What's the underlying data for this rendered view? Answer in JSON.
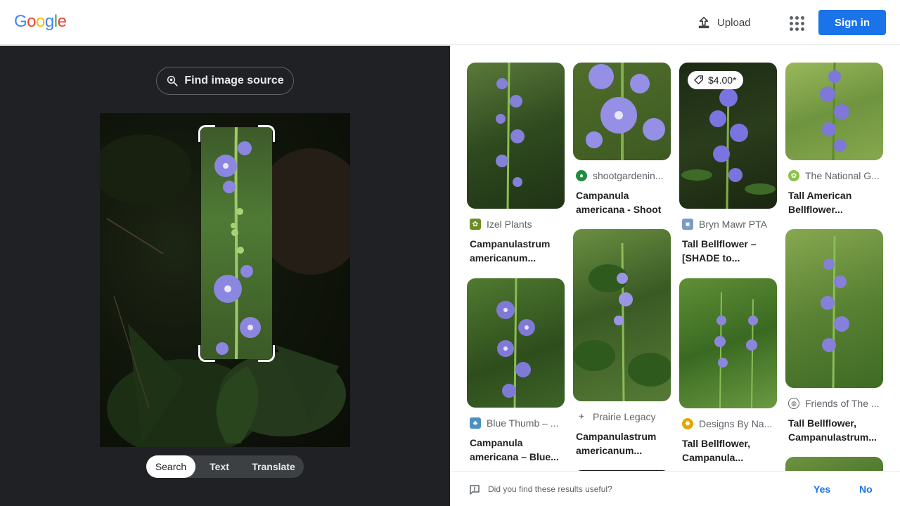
{
  "header": {
    "logo_letters": [
      "G",
      "o",
      "o",
      "g",
      "l",
      "e"
    ],
    "logo_colors": [
      "#4285f4",
      "#ea4335",
      "#fbbc05",
      "#4285f4",
      "#34a853",
      "#ea4335"
    ],
    "upload_label": "Upload",
    "apps_icon": "apps-grid-icon",
    "signin_label": "Sign in"
  },
  "left": {
    "find_source_label": "Find image source",
    "tabs": [
      {
        "label": "Search",
        "active": true
      },
      {
        "label": "Text",
        "active": false
      },
      {
        "label": "Translate",
        "active": false
      }
    ]
  },
  "results": [
    {
      "source": "Izel Plants",
      "title": "Campanulastrum americanum...",
      "icon_color": "#6b8e23",
      "price": ""
    },
    {
      "source": "Blue Thumb – ...",
      "title": "Campanula americana – Blue...",
      "icon_color": "#4a90c2",
      "price": ""
    },
    {
      "source": "shootgardenin...",
      "title": "Campanula americana - Shoot",
      "icon_color": "#1e8e3e",
      "price": ""
    },
    {
      "source": "Prairie Legacy",
      "title": "Campanulastrum americanum...",
      "icon_color": "#5f6368",
      "price": ""
    },
    {
      "source": "Bryn Mawr PTA",
      "title": "Tall Bellflower – [SHADE to...",
      "icon_color": "#7a9cc6",
      "price": "$4.00*"
    },
    {
      "source": "Designs By Na...",
      "title": "Tall Bellflower, Campanula...",
      "icon_color": "#e0a800",
      "price": ""
    },
    {
      "source": "The National G...",
      "title": "Tall American Bellflower...",
      "icon_color": "#8bc34a",
      "price": ""
    },
    {
      "source": "Friends of The ...",
      "title": "Tall Bellflower, Campanulastrum...",
      "icon_color": "#5f6368",
      "price": ""
    }
  ],
  "feedback": {
    "question": "Did you find these results useful?",
    "yes": "Yes",
    "no": "No"
  }
}
